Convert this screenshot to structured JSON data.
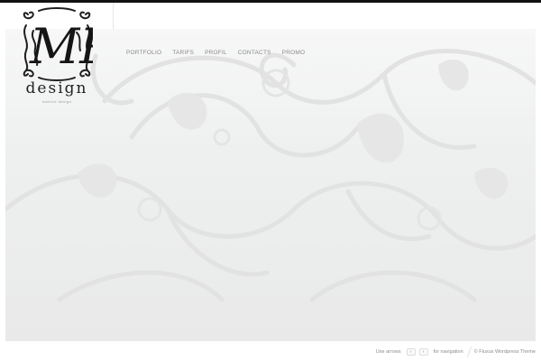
{
  "logo": {
    "monogram": "MP",
    "wordmark": "design",
    "tagline": "interior design"
  },
  "nav": {
    "items": [
      {
        "label": "PORTFOLIO"
      },
      {
        "label": "TARIFS"
      },
      {
        "label": "PROFIL"
      },
      {
        "label": "CONTACTS"
      },
      {
        "label": "PROMO"
      }
    ]
  },
  "slider": {
    "slide_count": 3,
    "active_index": 0
  },
  "footer": {
    "use_arrows": "Use arrows",
    "prev_arrow": "‹",
    "next_arrow": "›",
    "for_navigation": "for navigation",
    "credit": "© Fluxus Wordpress Theme"
  },
  "colors": {
    "top_bar": "#111111",
    "accent": "#3d7e9a",
    "slide_bg": "#eeeeee"
  }
}
